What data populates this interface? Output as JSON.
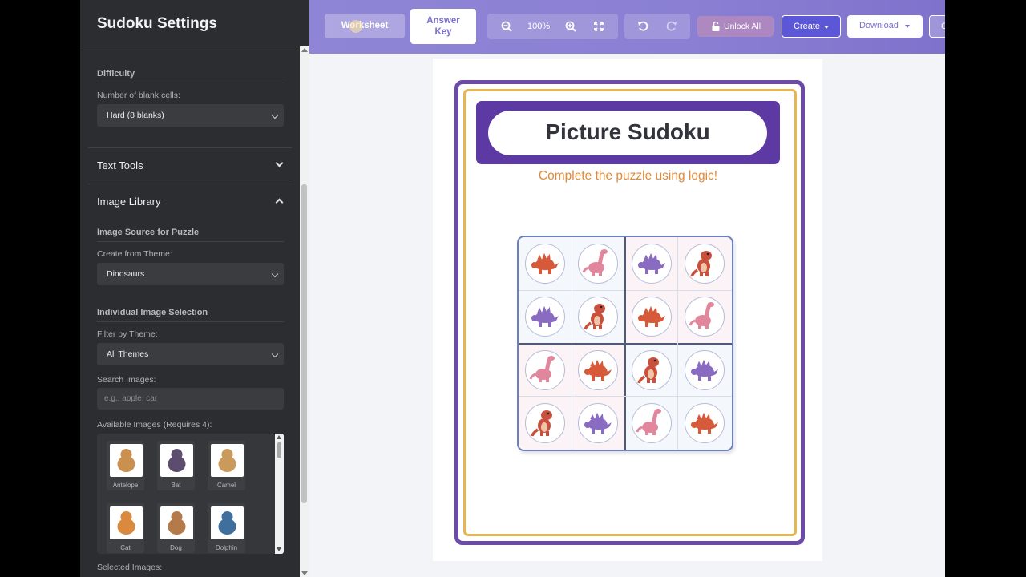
{
  "sidebar": {
    "title": "Sudoku Settings",
    "difficulty": {
      "heading": "Difficulty",
      "blank_label": "Number of blank cells:",
      "blank_value": "Hard (8 blanks)"
    },
    "text_tools": {
      "label": "Text Tools",
      "icon": "chevron-down-icon"
    },
    "image_library": {
      "label": "Image Library",
      "icon": "chevron-up-icon",
      "source_heading": "Image Source for Puzzle",
      "theme_label": "Create from Theme:",
      "theme_value": "Dinosaurs",
      "individual_heading": "Individual Image Selection",
      "filter_label": "Filter by Theme:",
      "filter_value": "All Themes",
      "search_label": "Search Images:",
      "search_placeholder": "e.g., apple, car",
      "available_label": "Available Images (Requires 4):",
      "images": [
        {
          "name": "Antelope",
          "icon": "antelope-icon",
          "color": "#c9904f"
        },
        {
          "name": "Bat",
          "icon": "bat-icon",
          "color": "#5c4d6e"
        },
        {
          "name": "Camel",
          "icon": "camel-icon",
          "color": "#c99a5c"
        },
        {
          "name": "Cat",
          "icon": "cat-icon",
          "color": "#d98a3f"
        },
        {
          "name": "Dog",
          "icon": "dog-icon",
          "color": "#b47a4a"
        },
        {
          "name": "Dolphin",
          "icon": "dolphin-icon",
          "color": "#3f6f9c"
        }
      ],
      "selected_label": "Selected Images:"
    }
  },
  "toolbar": {
    "worksheet": "Worksheet",
    "answer_key_line1": "Answer",
    "answer_key_line2": "Key",
    "zoom_out_icon": "zoom-out-icon",
    "zoom_level": "100%",
    "zoom_in_icon": "zoom-in-icon",
    "fit_icon": "fit-screen-icon",
    "undo_icon": "undo-icon",
    "redo_icon": "redo-icon",
    "unlock_all": "Unlock All",
    "lock_icon": "lock-icon",
    "create": "Create",
    "download": "Download",
    "extra": "C"
  },
  "worksheet": {
    "title": "Picture Sudoku",
    "subtitle": "Complete the puzzle using logic!",
    "colors": {
      "frame": "#6b4aa8",
      "inner_frame": "#e8b64e",
      "banner": "#5d3aa3",
      "subtitle": "#e08a3a"
    },
    "dinos": {
      "stego_red": {
        "icon": "red-stegosaurus-icon",
        "color": "#d65a3a"
      },
      "long_pink": {
        "icon": "pink-longneck-icon",
        "color": "#e1869c"
      },
      "stego_purple": {
        "icon": "purple-stegosaurus-icon",
        "color": "#8a6bc2"
      },
      "trex_red": {
        "icon": "red-trex-icon",
        "color": "#c9503d"
      }
    },
    "grid": [
      [
        "stego_red",
        "long_pink",
        "stego_purple",
        "trex_red"
      ],
      [
        "stego_purple",
        "trex_red",
        "stego_red",
        "long_pink"
      ],
      [
        "long_pink",
        "stego_red",
        "trex_red",
        "stego_purple"
      ],
      [
        "trex_red",
        "stego_purple",
        "long_pink",
        "stego_red"
      ]
    ]
  }
}
